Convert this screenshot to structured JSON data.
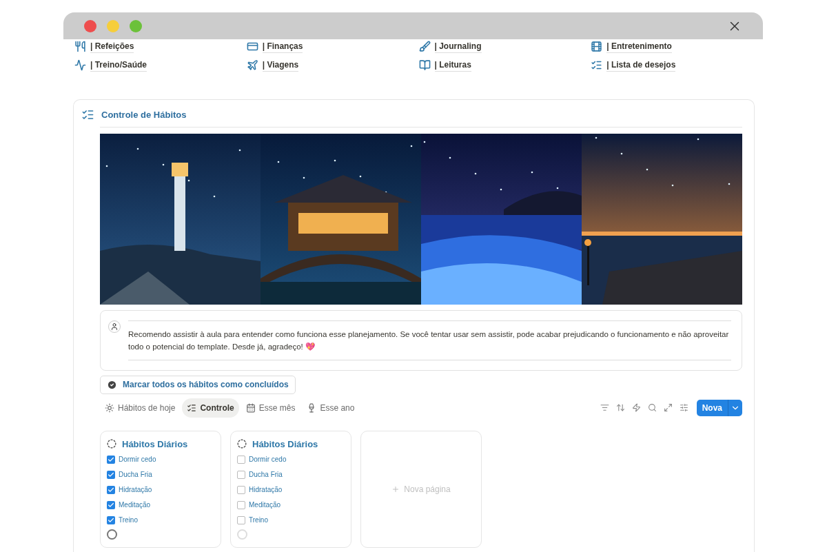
{
  "nav_links": [
    {
      "label": "| Refeições"
    },
    {
      "label": "| Finanças"
    },
    {
      "label": "| Journaling"
    },
    {
      "label": "| Entretenimento"
    },
    {
      "label": "| Treino/Saúde"
    },
    {
      "label": "| Viagens"
    },
    {
      "label": "| Leituras"
    },
    {
      "label": "| Lista de desejos"
    }
  ],
  "section": {
    "title": "Controle de Hábitos"
  },
  "callout": {
    "text": "Recomendo assistir à aula para entender como funciona esse planejamento. Se você tentar usar sem assistir, pode acabar prejudicando o funcionamento e não aproveitar todo o potencial do template. Desde já, agradeço! 💖"
  },
  "mark_all_button": "Marcar todos os hábitos como concluídos",
  "tabs": [
    {
      "label": "Hábitos de hoje",
      "selected": false
    },
    {
      "label": "Controle",
      "selected": true
    },
    {
      "label": "Esse mês",
      "selected": false
    },
    {
      "label": "Esse ano",
      "selected": false
    }
  ],
  "new_button": "Nova",
  "cards": [
    {
      "title": "Hábitos Diários",
      "complete": true,
      "items": [
        {
          "label": "Dormir cedo",
          "checked": true
        },
        {
          "label": "Ducha Fria",
          "checked": true
        },
        {
          "label": "Hidratação",
          "checked": true
        },
        {
          "label": "Meditação",
          "checked": true
        },
        {
          "label": "Treino",
          "checked": true
        }
      ]
    },
    {
      "title": "Hábitos Diários",
      "complete": false,
      "items": [
        {
          "label": "Dormir cedo",
          "checked": false
        },
        {
          "label": "Ducha Fria",
          "checked": false
        },
        {
          "label": "Hidratação",
          "checked": false
        },
        {
          "label": "Meditação",
          "checked": false
        },
        {
          "label": "Treino",
          "checked": false
        }
      ]
    }
  ],
  "new_page": "Nova página"
}
